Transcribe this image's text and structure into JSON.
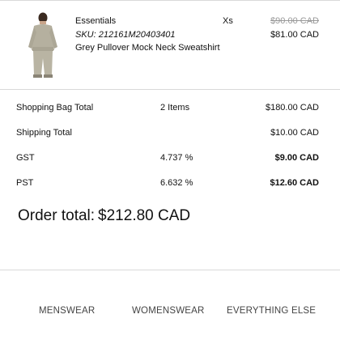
{
  "product": {
    "brand": "Essentials",
    "sku": "SKU: 212161M20403401",
    "name": "Grey Pullover Mock Neck Sweatshirt",
    "size": "Xs",
    "original_price": "$90.00 CAD",
    "sale_price": "$81.00 CAD"
  },
  "summary": {
    "shopping_bag": {
      "label": "Shopping Bag Total",
      "items": "2 Items",
      "value": "$180.00 CAD"
    },
    "shipping": {
      "label": "Shipping Total",
      "value": "$10.00 CAD"
    },
    "gst": {
      "label": "GST",
      "rate": "4.737 %",
      "value": "$9.00 CAD"
    },
    "pst": {
      "label": "PST",
      "rate": "6.632 %",
      "value": "$12.60 CAD"
    }
  },
  "order_total": {
    "label": "Order total:",
    "value": "$212.80 CAD"
  },
  "nav": {
    "menswear": "MENSWEAR",
    "womenswear": "WOMENSWEAR",
    "everything_else": "EVERYTHING ELSE"
  },
  "colors": {
    "divider": "#d9d9d9",
    "strikethrough": "#999999",
    "nav_text": "#444444",
    "sweatshirt": "#b5b09f"
  }
}
